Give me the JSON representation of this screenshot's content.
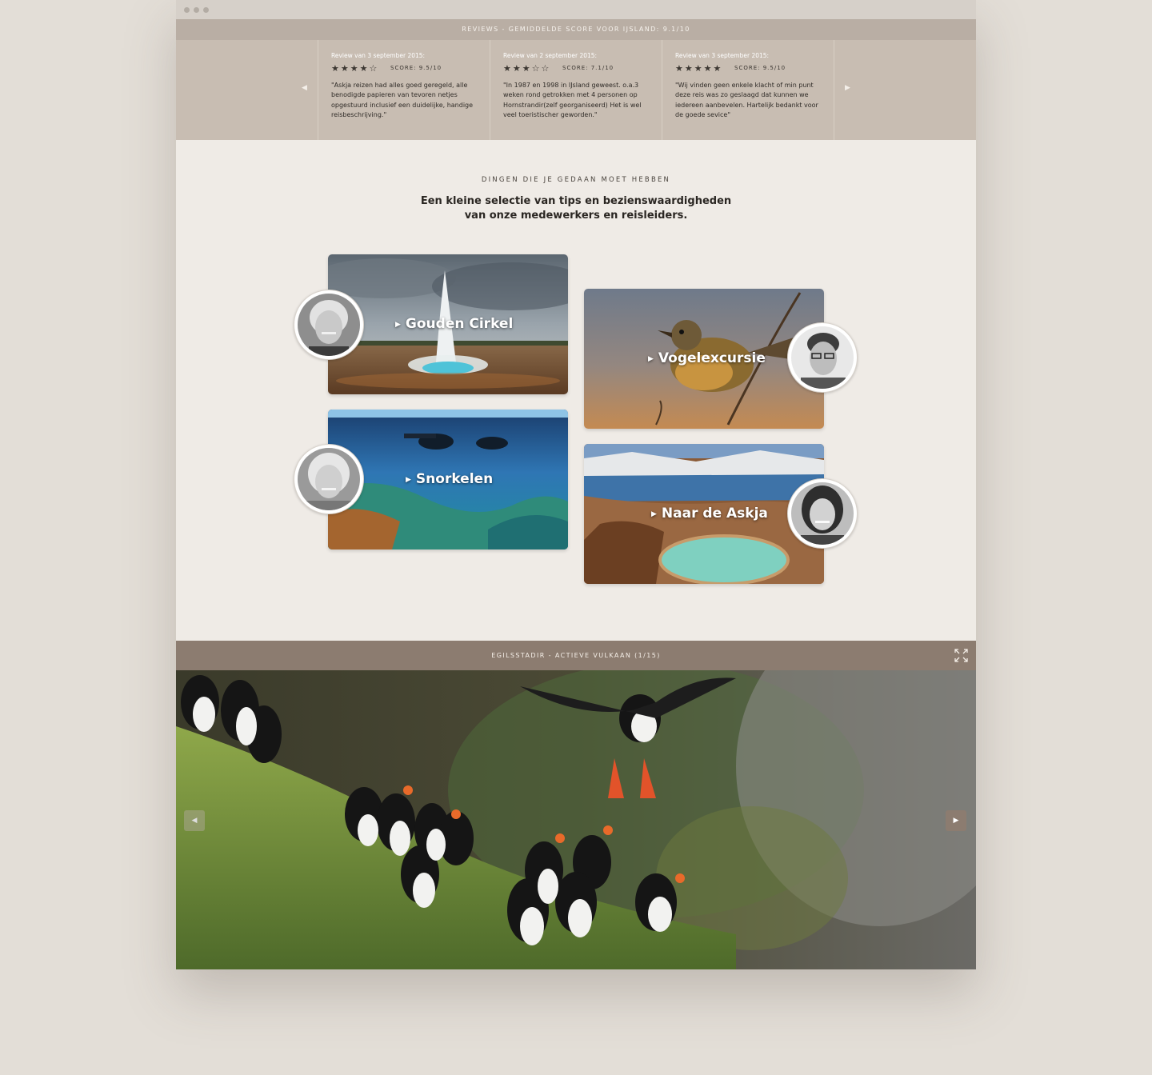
{
  "reviews": {
    "header": "REVIEWS - GEMIDDELDE SCORE VOOR IJSLAND: 9.1/10",
    "prev_icon": "◀",
    "next_icon": "▶",
    "items": [
      {
        "date": "Review van 3 september 2015:",
        "stars": "★★★★☆",
        "rating": 4,
        "score": "SCORE: 9.5/10",
        "text": "\"Askja reizen had alles goed geregeld, alle benodigde papieren van tevoren netjes opgestuurd inclusief een duidelijke, handige reisbeschrijving.\""
      },
      {
        "date": "Review van 2 september 2015:",
        "stars": "★★★☆☆",
        "rating": 3,
        "score": "SCORE: 7.1/10",
        "text": "\"In 1987 en 1998 in IJsland geweest. o.a.3 weken rond getrokken met 4 personen op Hornstrandir(zelf georganiseerd) Het is wel veel toeristischer geworden.\""
      },
      {
        "date": "Review van 3 september 2015:",
        "stars": "★★★★★",
        "rating": 5,
        "score": "SCORE: 9.5/10",
        "text": "\"Wij vinden geen enkele klacht of min punt deze reis was zo geslaagd dat kunnen we iedereen aanbevelen. Hartelijk bedankt voor de goede sevice\""
      }
    ]
  },
  "tips": {
    "kicker": "DINGEN DIE JE GEDAAN MOET HEBBEN",
    "heading": "Een kleine selectie van tips en bezienswaardigheden van onze medewerkers en reisleiders.",
    "play_icon": "▶",
    "cards": [
      {
        "label": "Gouden Cirkel"
      },
      {
        "label": "Vogelexcursie"
      },
      {
        "label": "Snorkelen"
      },
      {
        "label": "Naar de Askja"
      }
    ]
  },
  "gallery": {
    "title": "EGILSSTADIR - ACTIEVE VULKAAN (1/15)",
    "prev_icon": "◀",
    "next_icon": "▶"
  },
  "colors": {
    "page_bg": "#e3ded7",
    "content_bg": "#efebe6",
    "reviews_bar": "#b9aea4",
    "reviews_bg": "#c8bdb2",
    "gallery_bar": "#8c7c70"
  }
}
